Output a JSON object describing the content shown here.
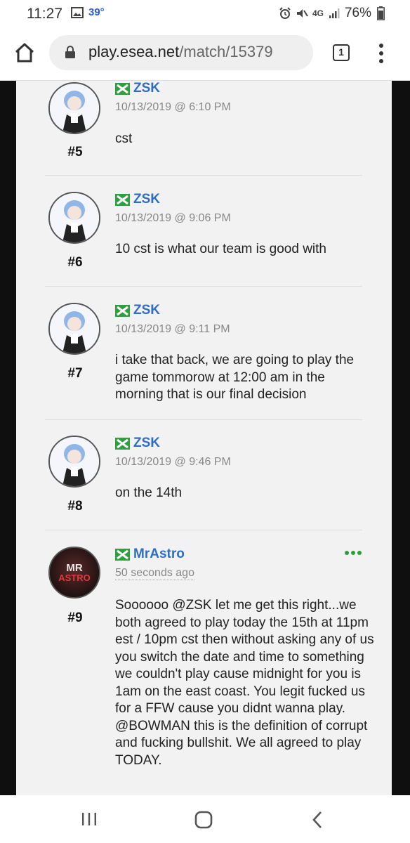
{
  "status_bar": {
    "time": "11:27",
    "temperature": "39°",
    "network": "4G",
    "battery": "76%"
  },
  "browser": {
    "url_host": "play.esea.net",
    "url_path": "/match/15379",
    "tab_count": "1"
  },
  "posts": [
    {
      "user": "ZSK",
      "date": "10/13/2019 @ 6:10 PM",
      "number": "#5",
      "body": "cst",
      "avatar": "anime-girl"
    },
    {
      "user": "ZSK",
      "date": "10/13/2019 @ 9:06 PM",
      "number": "#6",
      "body": "10 cst is what our team is good with",
      "avatar": "anime-girl"
    },
    {
      "user": "ZSK",
      "date": "10/13/2019 @ 9:11 PM",
      "number": "#7",
      "body": "i take that back, we are going to play the game tommorow at 12:00 am in the morning that is our final decision",
      "avatar": "anime-girl"
    },
    {
      "user": "ZSK",
      "date": "10/13/2019 @ 9:46 PM",
      "number": "#8",
      "body": "on the 14th",
      "avatar": "anime-girl"
    },
    {
      "user": "MrAstro",
      "date": "50 seconds ago",
      "number": "#9",
      "body": "Soooooo @ZSK let me get this right...we both agreed to play today the 15th at 11pm est / 10pm cst then without asking any of us you switch the date and time to something we couldn't play cause midnight for you is 1am on the east coast. You legit fucked us for a FFW cause you didnt wanna play. @BOWMAN this is the definition of corrupt and fucking bullshit. We all agreed to play TODAY.",
      "avatar": "mr-astro-logo",
      "avatar_text_top": "MR",
      "avatar_text_bottom": "ASTRO"
    }
  ],
  "colors": {
    "username": "#2f6ec4",
    "badge_green": "#2e9e3e",
    "more_dots": "#2e9e3e"
  }
}
